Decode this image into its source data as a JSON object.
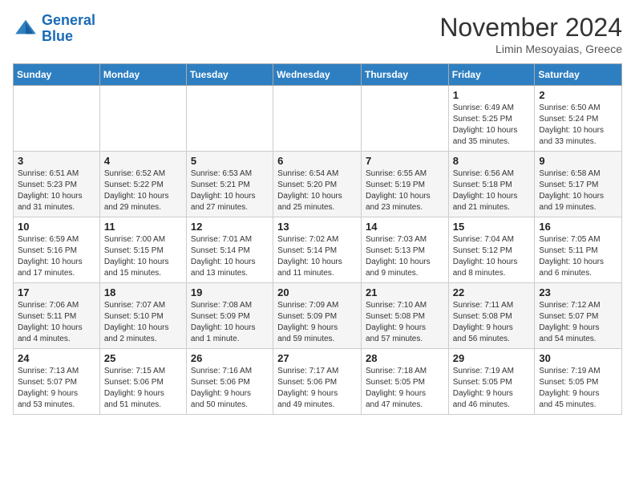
{
  "logo": {
    "line1": "General",
    "line2": "Blue"
  },
  "title": "November 2024",
  "location": "Limin Mesoyaias, Greece",
  "weekdays": [
    "Sunday",
    "Monday",
    "Tuesday",
    "Wednesday",
    "Thursday",
    "Friday",
    "Saturday"
  ],
  "weeks": [
    [
      {
        "day": "",
        "info": ""
      },
      {
        "day": "",
        "info": ""
      },
      {
        "day": "",
        "info": ""
      },
      {
        "day": "",
        "info": ""
      },
      {
        "day": "",
        "info": ""
      },
      {
        "day": "1",
        "info": "Sunrise: 6:49 AM\nSunset: 5:25 PM\nDaylight: 10 hours\nand 35 minutes."
      },
      {
        "day": "2",
        "info": "Sunrise: 6:50 AM\nSunset: 5:24 PM\nDaylight: 10 hours\nand 33 minutes."
      }
    ],
    [
      {
        "day": "3",
        "info": "Sunrise: 6:51 AM\nSunset: 5:23 PM\nDaylight: 10 hours\nand 31 minutes."
      },
      {
        "day": "4",
        "info": "Sunrise: 6:52 AM\nSunset: 5:22 PM\nDaylight: 10 hours\nand 29 minutes."
      },
      {
        "day": "5",
        "info": "Sunrise: 6:53 AM\nSunset: 5:21 PM\nDaylight: 10 hours\nand 27 minutes."
      },
      {
        "day": "6",
        "info": "Sunrise: 6:54 AM\nSunset: 5:20 PM\nDaylight: 10 hours\nand 25 minutes."
      },
      {
        "day": "7",
        "info": "Sunrise: 6:55 AM\nSunset: 5:19 PM\nDaylight: 10 hours\nand 23 minutes."
      },
      {
        "day": "8",
        "info": "Sunrise: 6:56 AM\nSunset: 5:18 PM\nDaylight: 10 hours\nand 21 minutes."
      },
      {
        "day": "9",
        "info": "Sunrise: 6:58 AM\nSunset: 5:17 PM\nDaylight: 10 hours\nand 19 minutes."
      }
    ],
    [
      {
        "day": "10",
        "info": "Sunrise: 6:59 AM\nSunset: 5:16 PM\nDaylight: 10 hours\nand 17 minutes."
      },
      {
        "day": "11",
        "info": "Sunrise: 7:00 AM\nSunset: 5:15 PM\nDaylight: 10 hours\nand 15 minutes."
      },
      {
        "day": "12",
        "info": "Sunrise: 7:01 AM\nSunset: 5:14 PM\nDaylight: 10 hours\nand 13 minutes."
      },
      {
        "day": "13",
        "info": "Sunrise: 7:02 AM\nSunset: 5:14 PM\nDaylight: 10 hours\nand 11 minutes."
      },
      {
        "day": "14",
        "info": "Sunrise: 7:03 AM\nSunset: 5:13 PM\nDaylight: 10 hours\nand 9 minutes."
      },
      {
        "day": "15",
        "info": "Sunrise: 7:04 AM\nSunset: 5:12 PM\nDaylight: 10 hours\nand 8 minutes."
      },
      {
        "day": "16",
        "info": "Sunrise: 7:05 AM\nSunset: 5:11 PM\nDaylight: 10 hours\nand 6 minutes."
      }
    ],
    [
      {
        "day": "17",
        "info": "Sunrise: 7:06 AM\nSunset: 5:11 PM\nDaylight: 10 hours\nand 4 minutes."
      },
      {
        "day": "18",
        "info": "Sunrise: 7:07 AM\nSunset: 5:10 PM\nDaylight: 10 hours\nand 2 minutes."
      },
      {
        "day": "19",
        "info": "Sunrise: 7:08 AM\nSunset: 5:09 PM\nDaylight: 10 hours\nand 1 minute."
      },
      {
        "day": "20",
        "info": "Sunrise: 7:09 AM\nSunset: 5:09 PM\nDaylight: 9 hours\nand 59 minutes."
      },
      {
        "day": "21",
        "info": "Sunrise: 7:10 AM\nSunset: 5:08 PM\nDaylight: 9 hours\nand 57 minutes."
      },
      {
        "day": "22",
        "info": "Sunrise: 7:11 AM\nSunset: 5:08 PM\nDaylight: 9 hours\nand 56 minutes."
      },
      {
        "day": "23",
        "info": "Sunrise: 7:12 AM\nSunset: 5:07 PM\nDaylight: 9 hours\nand 54 minutes."
      }
    ],
    [
      {
        "day": "24",
        "info": "Sunrise: 7:13 AM\nSunset: 5:07 PM\nDaylight: 9 hours\nand 53 minutes."
      },
      {
        "day": "25",
        "info": "Sunrise: 7:15 AM\nSunset: 5:06 PM\nDaylight: 9 hours\nand 51 minutes."
      },
      {
        "day": "26",
        "info": "Sunrise: 7:16 AM\nSunset: 5:06 PM\nDaylight: 9 hours\nand 50 minutes."
      },
      {
        "day": "27",
        "info": "Sunrise: 7:17 AM\nSunset: 5:06 PM\nDaylight: 9 hours\nand 49 minutes."
      },
      {
        "day": "28",
        "info": "Sunrise: 7:18 AM\nSunset: 5:05 PM\nDaylight: 9 hours\nand 47 minutes."
      },
      {
        "day": "29",
        "info": "Sunrise: 7:19 AM\nSunset: 5:05 PM\nDaylight: 9 hours\nand 46 minutes."
      },
      {
        "day": "30",
        "info": "Sunrise: 7:19 AM\nSunset: 5:05 PM\nDaylight: 9 hours\nand 45 minutes."
      }
    ]
  ]
}
